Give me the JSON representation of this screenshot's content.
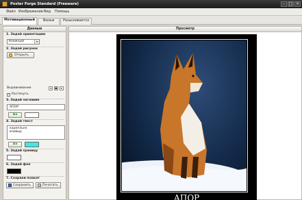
{
  "window": {
    "title": "Poster Forge Standard (Freeware)",
    "minimize": "–",
    "maximize": "□",
    "close": "×"
  },
  "menu": [
    "Файл",
    "Изображение",
    "Вид",
    "Помощь"
  ],
  "tabs": [
    "Мотивационный",
    "Фильм",
    "Разыскивается"
  ],
  "left_panel": {
    "header": "Данные",
    "s1_title": "1. Задай ориентацию",
    "orientation_value": "Книжный",
    "s2_title": "2. Задай рисунок",
    "open_button": "Открыть",
    "align_label": "Выравнивание",
    "stretch_label": "Растянуть",
    "stretch_checked": "✓",
    "s3_title": "3. Задай заглавие",
    "title_value": "АПОР",
    "s4_title": "4. Задай текст",
    "text_value": "карепльке\nвпивыр",
    "font_button": "Aa",
    "s5_title": "5. Задай границу",
    "s6_title": "6. Задай фон",
    "s7_title": "7. Сохрани плакат",
    "save_button": "Сохранить",
    "print_button": "Печатать"
  },
  "right_panel": {
    "header": "Просмотр",
    "poster_title": "АПОР"
  },
  "colors": {
    "title_color": "#ffffff",
    "text_color": "#41e7e8",
    "border_color": "#ffffff",
    "background_color": "#000000"
  }
}
